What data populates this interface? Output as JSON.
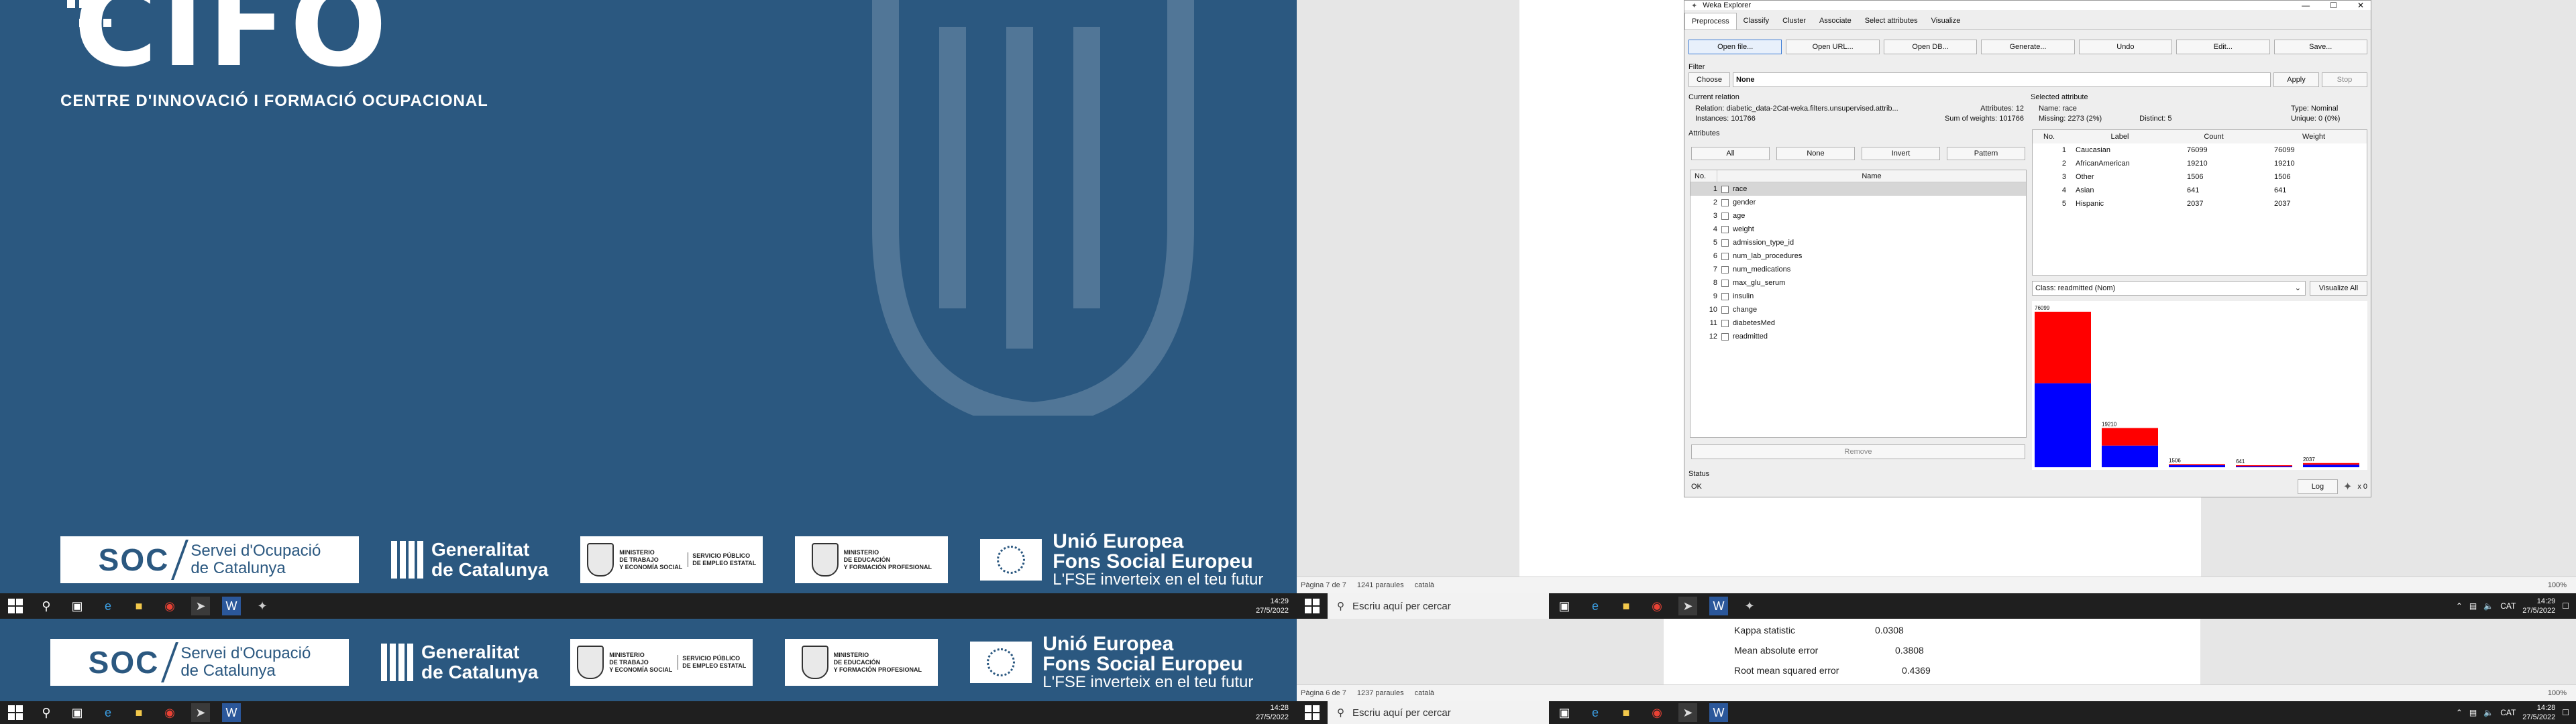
{
  "left_screen": {
    "logo": "CIFO",
    "centre_text": "CENTRE D'INNOVACIÓ I FORMACIÓ OCUPACIONAL",
    "soc": {
      "abbr": "SOC",
      "name_line1": "Servei d'Ocupació",
      "name_line2": "de Catalunya"
    },
    "generalitat": {
      "line1": "Generalitat",
      "line2": "de Catalunya"
    },
    "ministry1": {
      "line1": "MINISTERIO",
      "line2": "DE TRABAJO",
      "line3": "Y ECONOMÍA SOCIAL",
      "side1": "SERVICIO PÚBLICO",
      "side2": "DE EMPLEO ESTATAL"
    },
    "ministry2": {
      "line1": "MINISTERIO",
      "line2": "DE EDUCACIÓN",
      "line3": "Y FORMACIÓN PROFESIONAL"
    },
    "eu": {
      "title1": "Unió Europea",
      "title2": "Fons Social Europeu",
      "subtitle": "L'FSE inverteix en el teu futur"
    },
    "clock_top": {
      "time": "14:29",
      "date": "27/5/2022"
    },
    "clock_bottom": {
      "time": "14:28",
      "date": "27/5/2022"
    }
  },
  "word": {
    "status_top": {
      "page": "Pàgina 7 de 7",
      "words": "1241 paraules",
      "lang": "català",
      "zoom": "100%"
    },
    "status_bottom": {
      "page": "Pàgina 6 de 7",
      "words": "1237 paraules",
      "lang": "català",
      "zoom": "100%"
    },
    "doc_lines": [
      {
        "label": "Kappa statistic",
        "value": "0.0308"
      },
      {
        "label": "Mean absolute error",
        "value": "0.3808"
      },
      {
        "label": "Root mean squared error",
        "value": "0.4369"
      }
    ]
  },
  "taskbar_right": {
    "search_placeholder": "Escriu aquí per cercar",
    "lang": "CAT",
    "clock_top": {
      "time": "14:29",
      "date": "27/5/2022"
    },
    "clock_bottom": {
      "time": "14:28",
      "date": "27/5/2022"
    }
  },
  "weka": {
    "title": "Weka Explorer",
    "tabs": [
      "Preprocess",
      "Classify",
      "Cluster",
      "Associate",
      "Select attributes",
      "Visualize"
    ],
    "toolbar": [
      "Open file...",
      "Open URL...",
      "Open DB...",
      "Generate...",
      "Undo",
      "Edit...",
      "Save..."
    ],
    "filter": {
      "label": "Filter",
      "choose": "Choose",
      "value": "None",
      "apply": "Apply",
      "stop": "Stop"
    },
    "current_relation": {
      "header": "Current relation",
      "relation_label": "Relation:",
      "relation": "diabetic_data-2Cat-weka.filters.unsupervised.attrib...",
      "instances_label": "Instances:",
      "instances": "101766",
      "attributes_label": "Attributes:",
      "attributes": "12",
      "weights_label": "Sum of weights:",
      "weights": "101766"
    },
    "attributes_panel": {
      "header": "Attributes",
      "buttons": [
        "All",
        "None",
        "Invert",
        "Pattern"
      ],
      "col_no": "No.",
      "col_name": "Name",
      "items": [
        {
          "no": "1",
          "name": "race"
        },
        {
          "no": "2",
          "name": "gender"
        },
        {
          "no": "3",
          "name": "age"
        },
        {
          "no": "4",
          "name": "weight"
        },
        {
          "no": "5",
          "name": "admission_type_id"
        },
        {
          "no": "6",
          "name": "num_lab_procedures"
        },
        {
          "no": "7",
          "name": "num_medications"
        },
        {
          "no": "8",
          "name": "max_glu_serum"
        },
        {
          "no": "9",
          "name": "insulin"
        },
        {
          "no": "10",
          "name": "change"
        },
        {
          "no": "11",
          "name": "diabetesMed"
        },
        {
          "no": "12",
          "name": "readmitted"
        }
      ],
      "remove": "Remove"
    },
    "selected_attribute": {
      "header": "Selected attribute",
      "name_label": "Name:",
      "name": "race",
      "missing_label": "Missing:",
      "missing": "2273 (2%)",
      "distinct_label": "Distinct:",
      "distinct": "5",
      "type_label": "Type:",
      "type": "Nominal",
      "unique_label": "Unique:",
      "unique": "0 (0%)",
      "cols": [
        "No.",
        "Label",
        "Count",
        "Weight"
      ],
      "rows": [
        {
          "no": "1",
          "label": "Caucasian",
          "count": "76099",
          "weight": "76099"
        },
        {
          "no": "2",
          "label": "AfricanAmerican",
          "count": "19210",
          "weight": "19210"
        },
        {
          "no": "3",
          "label": "Other",
          "count": "1506",
          "weight": "1506"
        },
        {
          "no": "4",
          "label": "Asian",
          "count": "641",
          "weight": "641"
        },
        {
          "no": "5",
          "label": "Hispanic",
          "count": "2037",
          "weight": "2037"
        }
      ]
    },
    "class_select": "Class: readmitted (Nom)",
    "visualize_all": "Visualize All",
    "status": {
      "label": "Status",
      "text": "OK",
      "log": "Log",
      "count": "x 0"
    },
    "histogram": {
      "bars": [
        {
          "label": "76099",
          "total": 76099,
          "red_fraction": 0.46
        },
        {
          "label": "19210",
          "total": 19210,
          "red_fraction": 0.45
        },
        {
          "label": "1506",
          "total": 1506,
          "red_fraction": 0.35
        },
        {
          "label": "641",
          "total": 641,
          "red_fraction": 0.35
        },
        {
          "label": "2037",
          "total": 2037,
          "red_fraction": 0.4
        }
      ],
      "colors": {
        "red": "#ff0000",
        "blue": "#0000ff"
      }
    }
  }
}
